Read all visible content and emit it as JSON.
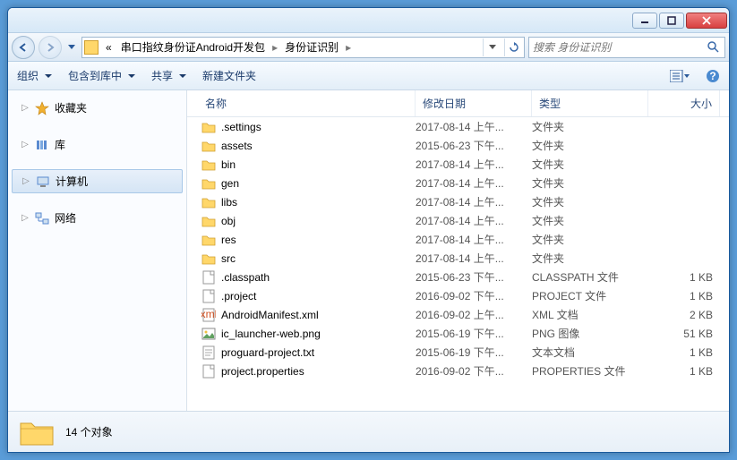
{
  "window": {
    "min_label": "minimize",
    "max_label": "maximize",
    "close_label": "close"
  },
  "breadcrumb": {
    "prefix": "«",
    "items": [
      "串口指纹身份证Android开发包",
      "身份证识别"
    ]
  },
  "search": {
    "placeholder": "搜索 身份证识别"
  },
  "toolbar": {
    "organize": "组织",
    "include": "包含到库中",
    "share": "共享",
    "newfolder": "新建文件夹"
  },
  "sidebar": {
    "items": [
      {
        "label": "收藏夹",
        "icon": "star"
      },
      {
        "label": "库",
        "icon": "library"
      },
      {
        "label": "计算机",
        "icon": "computer",
        "selected": true
      },
      {
        "label": "网络",
        "icon": "network"
      }
    ]
  },
  "columns": {
    "name": "名称",
    "date": "修改日期",
    "type": "类型",
    "size": "大小"
  },
  "files": [
    {
      "name": ".settings",
      "date": "2017-08-14 上午...",
      "type": "文件夹",
      "size": "",
      "icon": "folder"
    },
    {
      "name": "assets",
      "date": "2015-06-23 下午...",
      "type": "文件夹",
      "size": "",
      "icon": "folder"
    },
    {
      "name": "bin",
      "date": "2017-08-14 上午...",
      "type": "文件夹",
      "size": "",
      "icon": "folder"
    },
    {
      "name": "gen",
      "date": "2017-08-14 上午...",
      "type": "文件夹",
      "size": "",
      "icon": "folder"
    },
    {
      "name": "libs",
      "date": "2017-08-14 上午...",
      "type": "文件夹",
      "size": "",
      "icon": "folder"
    },
    {
      "name": "obj",
      "date": "2017-08-14 上午...",
      "type": "文件夹",
      "size": "",
      "icon": "folder"
    },
    {
      "name": "res",
      "date": "2017-08-14 上午...",
      "type": "文件夹",
      "size": "",
      "icon": "folder"
    },
    {
      "name": "src",
      "date": "2017-08-14 上午...",
      "type": "文件夹",
      "size": "",
      "icon": "folder"
    },
    {
      "name": ".classpath",
      "date": "2015-06-23 下午...",
      "type": "CLASSPATH 文件",
      "size": "1 KB",
      "icon": "file"
    },
    {
      "name": ".project",
      "date": "2016-09-02 下午...",
      "type": "PROJECT 文件",
      "size": "1 KB",
      "icon": "file"
    },
    {
      "name": "AndroidManifest.xml",
      "date": "2016-09-02 上午...",
      "type": "XML 文档",
      "size": "2 KB",
      "icon": "xml"
    },
    {
      "name": "ic_launcher-web.png",
      "date": "2015-06-19 下午...",
      "type": "PNG 图像",
      "size": "51 KB",
      "icon": "png"
    },
    {
      "name": "proguard-project.txt",
      "date": "2015-06-19 下午...",
      "type": "文本文档",
      "size": "1 KB",
      "icon": "txt"
    },
    {
      "name": "project.properties",
      "date": "2016-09-02 下午...",
      "type": "PROPERTIES 文件",
      "size": "1 KB",
      "icon": "file"
    }
  ],
  "status": {
    "count_label": "14 个对象"
  }
}
